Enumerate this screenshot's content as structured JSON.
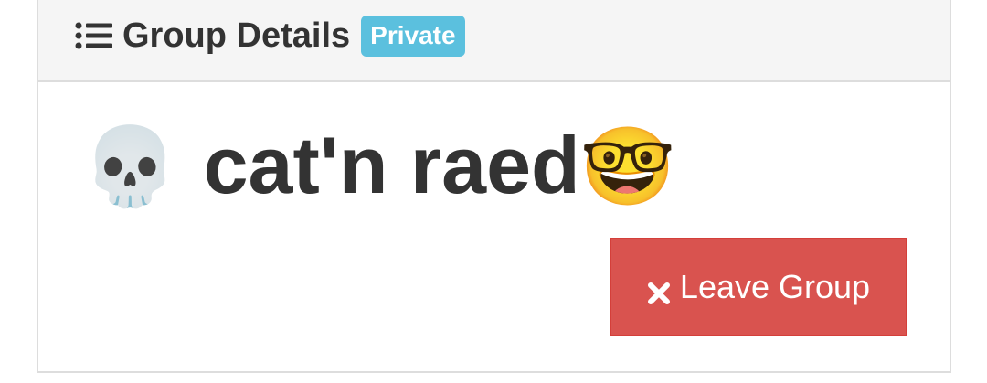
{
  "header": {
    "title": "Group Details",
    "badge": "Private",
    "icon": "list-icon"
  },
  "group": {
    "name_prefix_emoji": "💀",
    "name": "cat'n raed",
    "name_suffix_emoji": "🤓"
  },
  "actions": {
    "leave_label": "Leave Group",
    "leave_icon": "times-icon"
  },
  "colors": {
    "badge": "#5bc0de",
    "danger": "#d9534f",
    "heading_bg": "#f5f5f5",
    "text": "#333333"
  }
}
